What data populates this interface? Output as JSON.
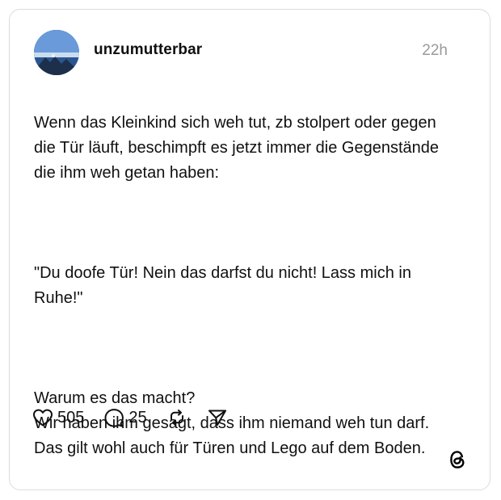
{
  "post": {
    "username": "unzumutterbar",
    "time": "22h",
    "text_paragraphs": [
      "Wenn das Kleinkind sich weh tut, zb stolpert oder gegen die Tür läuft, beschimpft es jetzt immer die Gegenstände die ihm weh getan haben:",
      "\"Du doofe Tür! Nein das darfst du nicht! Lass mich in Ruhe!\"",
      "Warum es das macht?\nWir haben ihm gesagt, dass ihm niemand weh tun darf.\nDas gilt wohl auch für Türen und Lego auf dem Boden."
    ]
  },
  "actions": {
    "like_count": "505",
    "comment_count": "25",
    "like_icon": "heart-icon",
    "comment_icon": "speech-bubble-icon",
    "repost_icon": "repost-icon",
    "share_icon": "send-icon"
  },
  "branding": {
    "logo_icon": "threads-logo-icon"
  },
  "colors": {
    "text": "#101010",
    "muted": "#9a9a9a",
    "border": "#dcdcdc"
  }
}
